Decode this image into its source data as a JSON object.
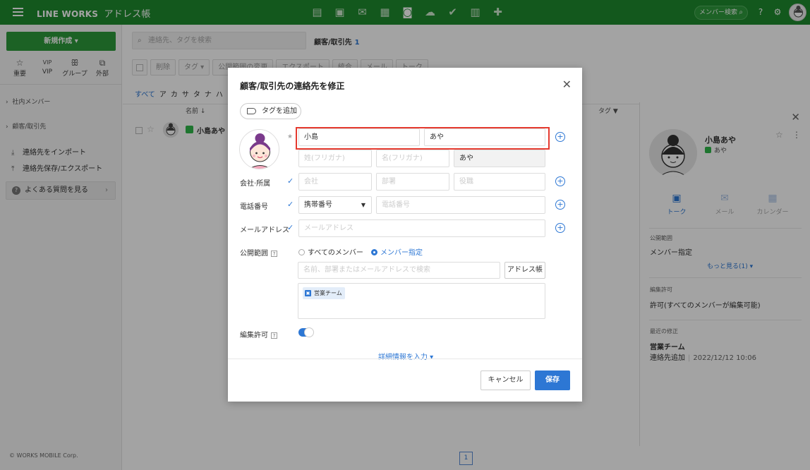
{
  "header": {
    "brand": "LINE WORKS",
    "app_name": "アドレス帳",
    "member_search": "メンバー検索",
    "apps": [
      "note-icon",
      "talk-icon",
      "mail-icon",
      "calendar-icon",
      "contacts-icon",
      "drive-icon",
      "task-icon",
      "form-icon",
      "puzzle-icon"
    ]
  },
  "sidebar": {
    "new_button": "新規作成 ▾",
    "quick": [
      {
        "label": "重要",
        "icon": "☆"
      },
      {
        "label": "VIP",
        "icon": "VIP"
      },
      {
        "label": "グループ",
        "icon": "ꕥ"
      },
      {
        "label": "外部",
        "icon": "⧉"
      }
    ],
    "groups": [
      "社内メンバー",
      "顧客/取引先"
    ],
    "links": [
      "連絡先をインポート",
      "連絡先保存/エクスポート"
    ],
    "faq": "よくある質問を見る",
    "copyright": "© WORKS MOBILE Corp."
  },
  "main": {
    "search_placeholder": "連絡先、タグを検索",
    "breadcrumb": "顧客/取引先",
    "count": "1",
    "toolbar": [
      "削除",
      "タグ ▾",
      "公開範囲の変更",
      "エクスポート",
      "統合",
      "メール",
      "トーク"
    ],
    "alpha": [
      "すべて",
      "ア",
      "カ",
      "サ",
      "タ",
      "ナ",
      "ハ"
    ],
    "col_name": "名前 ↓",
    "col_tag": "タグ ▼",
    "row_name": "小島あや",
    "page": "1"
  },
  "detail": {
    "name": "小島あや",
    "sub": "あや",
    "actions": [
      "トーク",
      "メール",
      "カレンダー"
    ],
    "scope_label": "公開範囲",
    "scope_value": "メンバー指定",
    "more_link": "もっと見る(1) ▾",
    "edit_label": "編集許可",
    "edit_value": "許可(すべてのメンバーが編集可能)",
    "recent_label": "最近の修正",
    "recent_team": "営業チーム",
    "recent_action": "連絡先追加",
    "recent_time": "2022/12/12 10:06"
  },
  "modal": {
    "title": "顧客/取引先の連絡先を修正",
    "tag_button": "タグを追加",
    "last_name": "小島",
    "first_name": "あや",
    "last_kana_placeholder": "姓(フリガナ)",
    "first_kana_placeholder": "名(フリガナ)",
    "nickname": "あや",
    "company_label": "会社·所属",
    "company_placeholder": "会社",
    "dept_placeholder": "部署",
    "title_placeholder": "役職",
    "phone_label": "電話番号",
    "phone_type": "携帯番号",
    "phone_placeholder": "電話番号",
    "email_label": "メールアドレス",
    "email_placeholder": "メールアドレス",
    "scope_label": "公開範囲",
    "scope_all": "すべてのメンバー",
    "scope_members": "メンバー指定",
    "member_search_placeholder": "名前、部署またはメールアドレスで検索",
    "addressbook_button": "アドレス帳",
    "member_chip": "営業チーム",
    "edit_label": "編集許可",
    "more_details": "詳細情報を入力 ▾",
    "cancel": "キャンセル",
    "save": "保存"
  },
  "colors": {
    "header": "#1f8a2e",
    "accent": "#2d77d4",
    "highlight": "#e53a2f"
  }
}
